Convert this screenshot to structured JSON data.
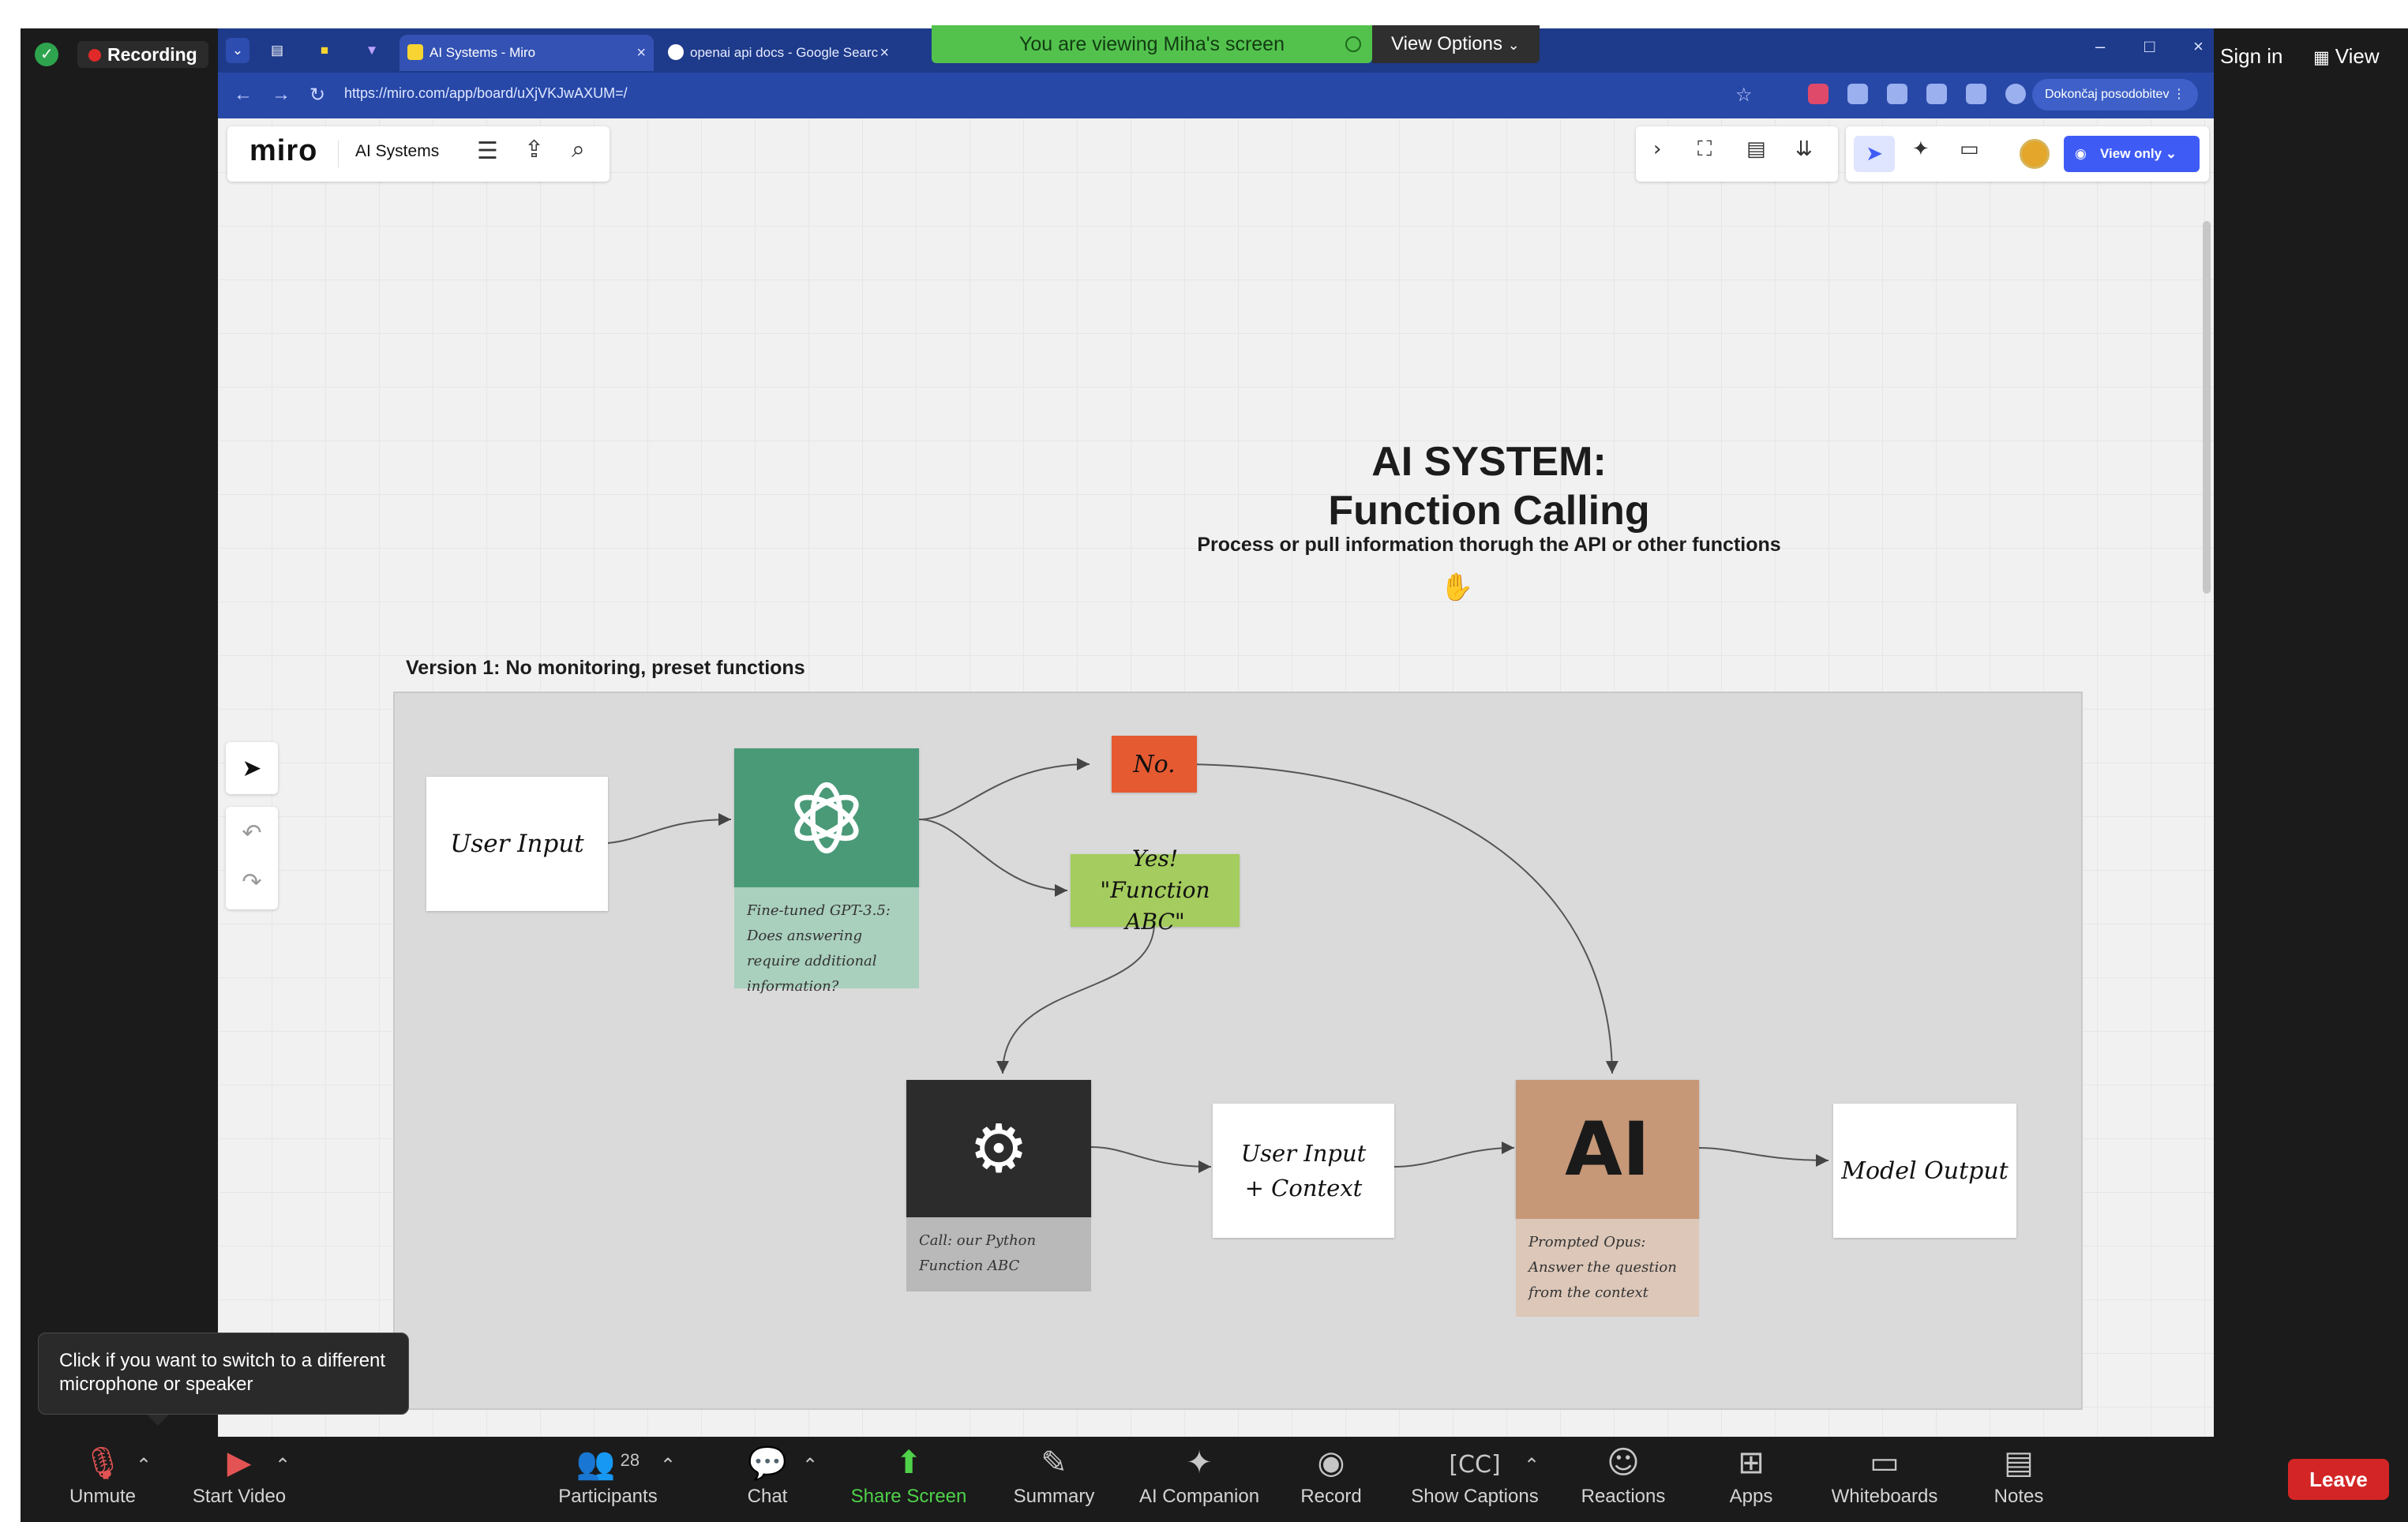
{
  "zoom": {
    "recording_label": "Recording",
    "sign_in": "Sign in",
    "view": "View",
    "share_banner": "You are viewing Miha's screen",
    "view_options": "View Options"
  },
  "browser": {
    "tabs": [
      {
        "label": "AI Systems - Miro",
        "active": true
      },
      {
        "label": "openai api docs - Google Searc",
        "active": false
      }
    ],
    "url": "https://miro.com/app/board/uXjVKJwAXUM=/",
    "profile_button": "Dokončaj posodobitev"
  },
  "miro": {
    "logo": "miro",
    "board_name": "AI Systems",
    "view_only": "View only",
    "title_line1": "AI SYSTEM:",
    "title_line2": "Function Calling",
    "subtitle": "Process or pull information thorugh the API or other functions",
    "version_label": "Version 1: No monitoring, preset functions",
    "nodes": {
      "user_input": "User Input",
      "gpt_caption": "Fine-tuned GPT-3.5: Does answering require additional information?",
      "no": "No.",
      "yes_line1": "Yes!",
      "yes_line2": "\"Function ABC\"",
      "function_caption": "Call: our Python Function ABC",
      "user_input_context": "User Input + Context",
      "ai_logo": "AI",
      "opus_caption": "Prompted Opus: Answer the question from the context",
      "model_output": "Model Output"
    },
    "colors": {
      "gpt_green": "#4a9a78",
      "gpt_caption": "#a9cfbd",
      "no_red": "#e55a31",
      "yes_green": "#a4cc5e",
      "gear_dark": "#2c2c2c",
      "gear_caption": "#b9b9b9",
      "opus_tan": "#c69878",
      "opus_caption": "#dcc7b8"
    }
  },
  "tooltip": "Click if you want to switch to a different microphone or speaker",
  "bottombar": {
    "unmute": "Unmute",
    "start_video": "Start Video",
    "participants_count": "28",
    "participants": "Participants",
    "chat": "Chat",
    "share_screen": "Share Screen",
    "summary": "Summary",
    "ai_companion": "AI Companion",
    "record": "Record",
    "show_captions": "Show Captions",
    "reactions": "Reactions",
    "apps": "Apps",
    "whiteboards": "Whiteboards",
    "notes": "Notes",
    "leave": "Leave"
  }
}
